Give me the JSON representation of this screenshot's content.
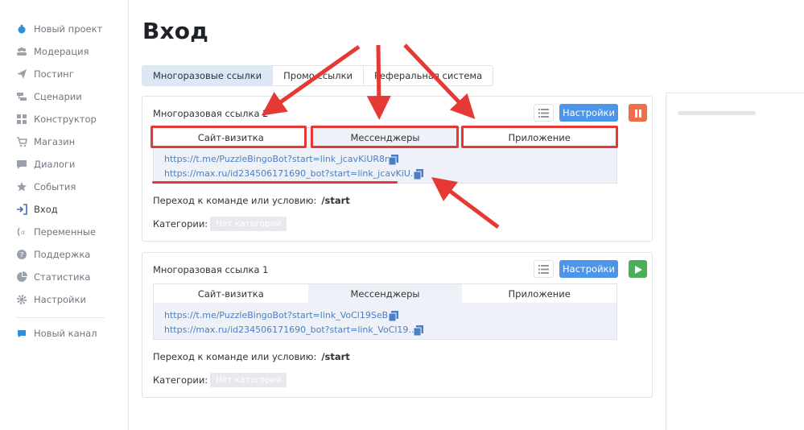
{
  "sidebar": {
    "items": [
      {
        "label": "Новый проект",
        "icon": "project-icon"
      },
      {
        "label": "Модерация",
        "icon": "users-icon"
      },
      {
        "label": "Постинг",
        "icon": "send-icon"
      },
      {
        "label": "Сценарии",
        "icon": "scenario-icon"
      },
      {
        "label": "Конструктор",
        "icon": "grid-icon"
      },
      {
        "label": "Магазин",
        "icon": "cart-icon"
      },
      {
        "label": "Диалоги",
        "icon": "chat-icon"
      },
      {
        "label": "События",
        "icon": "star-icon"
      },
      {
        "label": "Вход",
        "icon": "login-icon"
      },
      {
        "label": "Переменные",
        "icon": "variable-icon"
      },
      {
        "label": "Поддержка",
        "icon": "help-icon"
      },
      {
        "label": "Статистика",
        "icon": "pie-icon"
      },
      {
        "label": "Настройки",
        "icon": "gear-icon"
      }
    ],
    "new_channel": {
      "label": "Новый канал",
      "icon": "channel-icon"
    }
  },
  "page": {
    "title": "Вход"
  },
  "tabs": [
    {
      "label": "Многоразовые ссылки"
    },
    {
      "label": "Промо ссылки"
    },
    {
      "label": "Реферальная система"
    }
  ],
  "cards": [
    {
      "title": "Многоразовая ссылка 2",
      "settings_label": "Настройки",
      "state": "pause",
      "link_tabs": [
        "Сайт-визитка",
        "Мессенджеры",
        "Приложение"
      ],
      "links": [
        "https://t.me/PuzzleBingoBot?start=link_jcavKiUR8m",
        "https://max.ru/id234506171690_bot?start=link_jcavKiU..."
      ],
      "command_label": "Переход к команде или условию:",
      "command_value": "/start",
      "categories_label": "Категории:",
      "categories_value": "Нет категорий"
    },
    {
      "title": "Многоразовая ссылка 1",
      "settings_label": "Настройки",
      "state": "play",
      "link_tabs": [
        "Сайт-визитка",
        "Мессенджеры",
        "Приложение"
      ],
      "links": [
        "https://t.me/PuzzleBingoBot?start=link_VoCl19SeBr",
        "https://max.ru/id234506171690_bot?start=link_VoCl19..."
      ],
      "command_label": "Переход к команде или условию:",
      "command_value": "/start",
      "categories_label": "Категории:",
      "categories_value": "Нет категорий"
    }
  ],
  "colors": {
    "accent": "#4c95e8",
    "annotation": "#e53935",
    "pause": "#f06f4a",
    "play": "#4cae56",
    "link": "#4a7fc4"
  }
}
